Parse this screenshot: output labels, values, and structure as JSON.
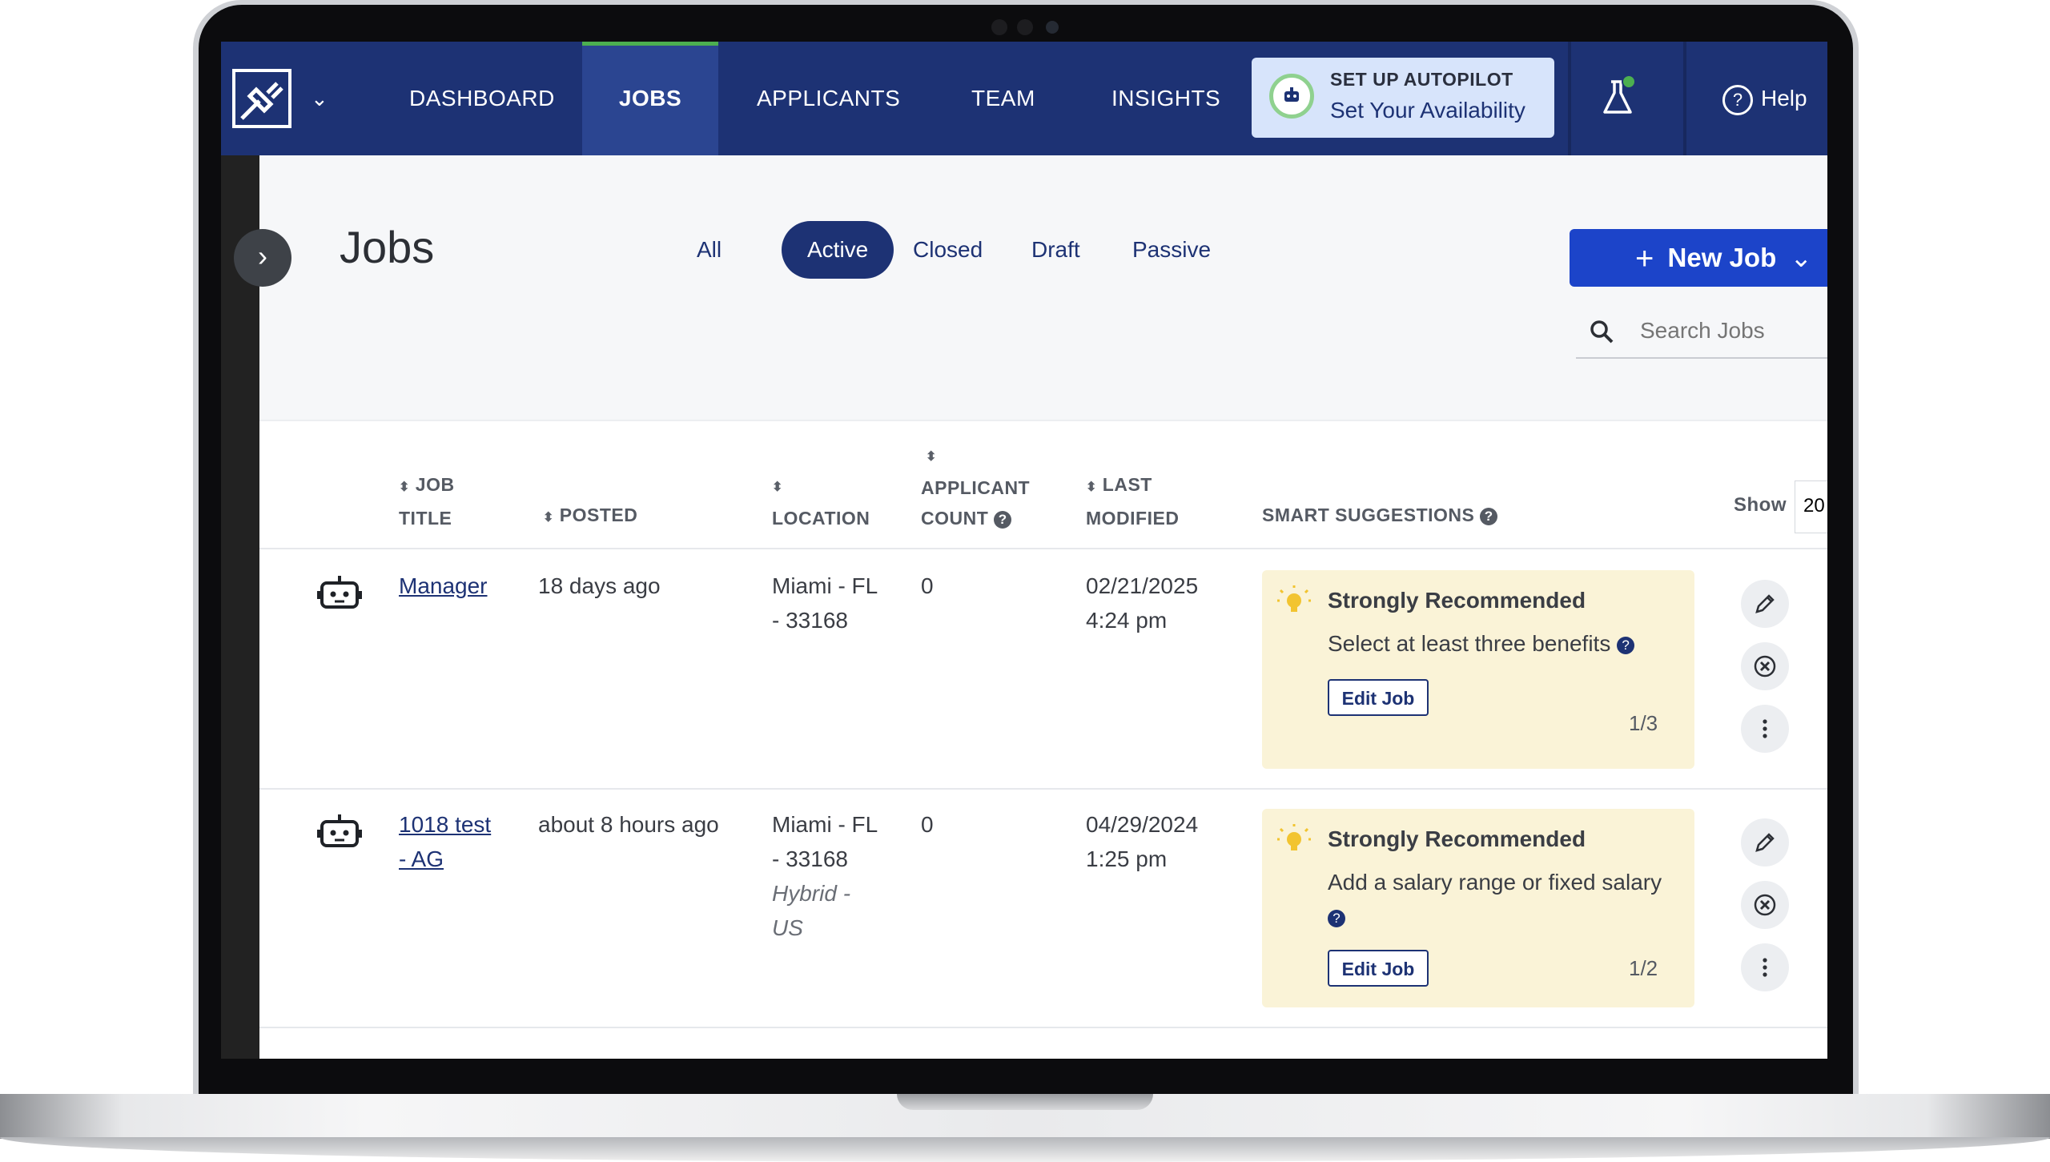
{
  "nav": {
    "items": [
      "DASHBOARD",
      "JOBS",
      "APPLICANTS",
      "TEAM",
      "INSIGHTS"
    ],
    "autopilot_title": "SET UP AUTOPILOT",
    "autopilot_sub": "Set Your Availability",
    "help_label": "Help",
    "accent": "#4caf50"
  },
  "page": {
    "title": "Jobs",
    "filters": [
      "All",
      "Active",
      "Closed",
      "Draft",
      "Passive"
    ],
    "active_filter": "Active",
    "new_job_label": "New Job",
    "search_placeholder": "Search Jobs"
  },
  "table": {
    "headers": {
      "job_title_1": "JOB",
      "job_title_2": "TITLE",
      "posted": "POSTED",
      "location": "LOCATION",
      "count_1": "APPLICANT",
      "count_2": "COUNT",
      "modified_1": "LAST",
      "modified_2": "MODIFIED",
      "suggestions": "SMART SUGGESTIONS"
    },
    "show_label": "Show",
    "show_value": "20",
    "rows": [
      {
        "title_line1": "Manager",
        "title_line2": "",
        "posted": "18 days ago",
        "location_line1": "Miami - FL",
        "location_line2": "- 33168",
        "location_type_1": "",
        "location_type_2": "",
        "count": "0",
        "modified_date": "02/21/2025",
        "modified_time": "4:24 pm",
        "suggestion_title": "Strongly Recommended",
        "suggestion_text": "Select at least three benefits",
        "suggestion_button": "Edit Job",
        "suggestion_count": "1/3"
      },
      {
        "title_line1": "1018 test",
        "title_line2": "- AG",
        "posted": "about 8 hours ago",
        "location_line1": "Miami - FL",
        "location_line2": "- 33168",
        "location_type_1": "Hybrid -",
        "location_type_2": "US",
        "count": "0",
        "modified_date": "04/29/2024",
        "modified_time": "1:25 pm",
        "suggestion_title": "Strongly Recommended",
        "suggestion_text": "Add a salary range or fixed salary",
        "suggestion_button": "Edit Job",
        "suggestion_count": "1/2"
      }
    ]
  }
}
